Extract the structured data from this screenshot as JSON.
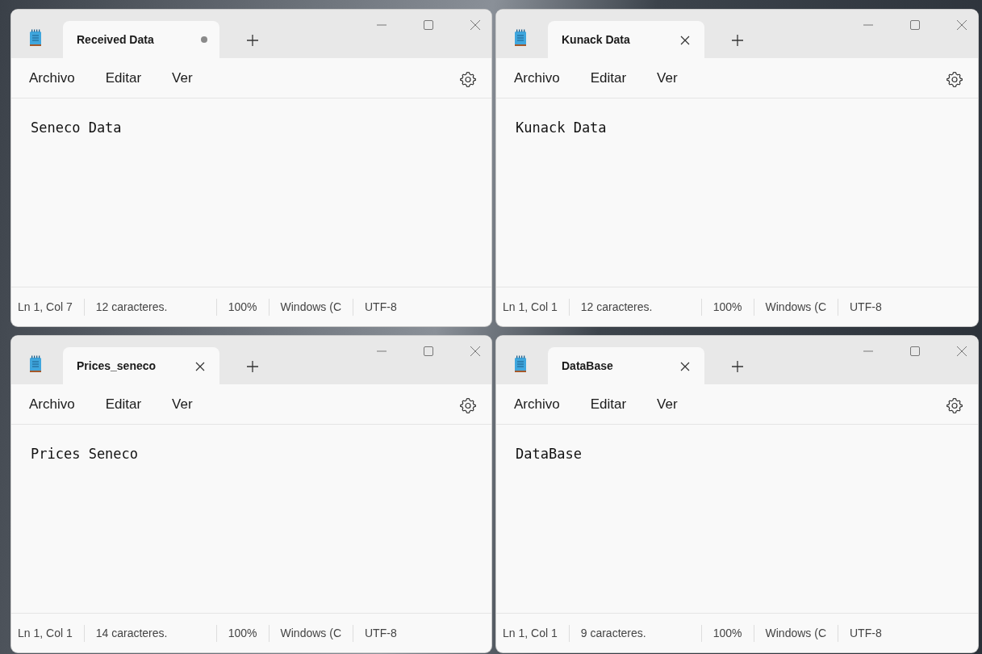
{
  "windows": [
    {
      "tab": {
        "title": "Received Data",
        "modified": true
      },
      "menu": [
        "Archivo",
        "Editar",
        "Ver"
      ],
      "content": "Seneco Data",
      "status": [
        "Ln 1, Col 7",
        "12 caracteres.",
        "100%",
        "Windows (C",
        "UTF-8"
      ]
    },
    {
      "tab": {
        "title": "Kunack Data",
        "modified": false
      },
      "menu": [
        "Archivo",
        "Editar",
        "Ver"
      ],
      "content": "Kunack Data",
      "status": [
        "Ln 1, Col 1",
        "12 caracteres.",
        "100%",
        "Windows (C",
        "UTF-8"
      ]
    },
    {
      "tab": {
        "title": "Prices_seneco",
        "modified": false
      },
      "menu": [
        "Archivo",
        "Editar",
        "Ver"
      ],
      "content": "Prices Seneco",
      "status": [
        "Ln 1, Col 1",
        "14 caracteres.",
        "100%",
        "Windows (C",
        "UTF-8"
      ]
    },
    {
      "tab": {
        "title": "DataBase",
        "modified": false
      },
      "menu": [
        "Archivo",
        "Editar",
        "Ver"
      ],
      "content": "DataBase",
      "status": [
        "Ln 1, Col 1",
        "9 caracteres.",
        "100%",
        "Windows (C",
        "UTF-8"
      ]
    }
  ]
}
